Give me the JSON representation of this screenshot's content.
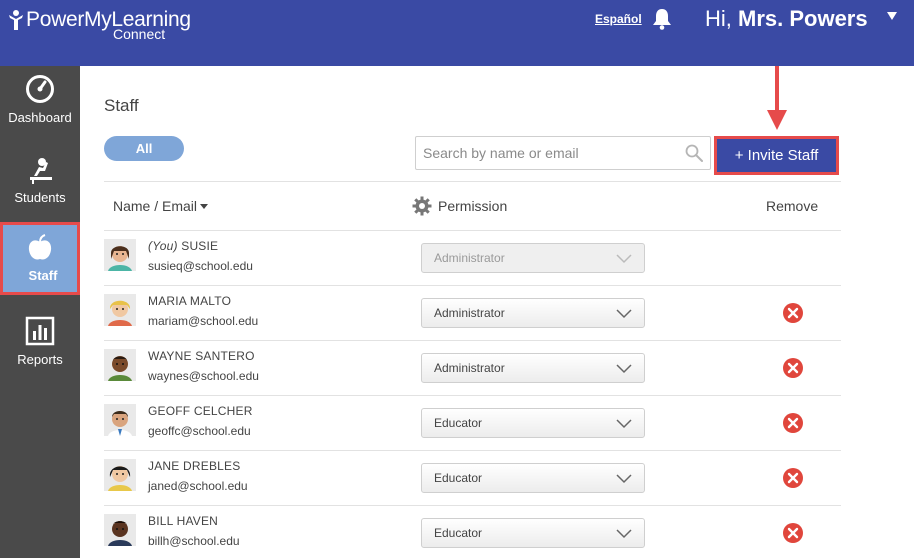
{
  "header": {
    "brand": "PowerMyLearning",
    "brand_sub": "Connect",
    "lang_link": "Español",
    "greeting_prefix": "Hi, ",
    "user_name": "Mrs. Powers"
  },
  "sidebar": {
    "items": [
      {
        "label": "Dashboard",
        "icon": "dashboard-gauge-icon",
        "active": false
      },
      {
        "label": "Students",
        "icon": "student-desk-icon",
        "active": false
      },
      {
        "label": "Staff",
        "icon": "apple-icon",
        "active": true
      },
      {
        "label": "Reports",
        "icon": "bar-chart-icon",
        "active": false
      }
    ]
  },
  "main": {
    "title": "Staff",
    "filter_all": "All",
    "search_placeholder": "Search by name or email",
    "invite_label": "+ Invite Staff",
    "columns": {
      "name": "Name / Email",
      "permission": "Permission",
      "remove": "Remove"
    },
    "staff": [
      {
        "you_tag": "(You)",
        "name": "SUSIE",
        "email": "susieq@school.edu",
        "permission": "Administrator",
        "editable": false,
        "removable": false
      },
      {
        "you_tag": "",
        "name": "MARIA MALTO",
        "email": "mariam@school.edu",
        "permission": "Administrator",
        "editable": true,
        "removable": true
      },
      {
        "you_tag": "",
        "name": "WAYNE SANTERO",
        "email": "waynes@school.edu",
        "permission": "Administrator",
        "editable": true,
        "removable": true
      },
      {
        "you_tag": "",
        "name": "GEOFF CELCHER",
        "email": "geoffc@school.edu",
        "permission": "Educator",
        "editable": true,
        "removable": true
      },
      {
        "you_tag": "",
        "name": "JANE DREBLES",
        "email": "janed@school.edu",
        "permission": "Educator",
        "editable": true,
        "removable": true
      },
      {
        "you_tag": "",
        "name": "BILL HAVEN",
        "email": "billh@school.edu",
        "permission": "Educator",
        "editable": true,
        "removable": true
      }
    ]
  },
  "colors": {
    "header_bg": "#3a4aa4",
    "sidebar_bg": "#4a4a4a",
    "active_tab_bg": "#7fa6d8",
    "highlight_red": "#e64b4b",
    "remove_red": "#e0463c"
  }
}
